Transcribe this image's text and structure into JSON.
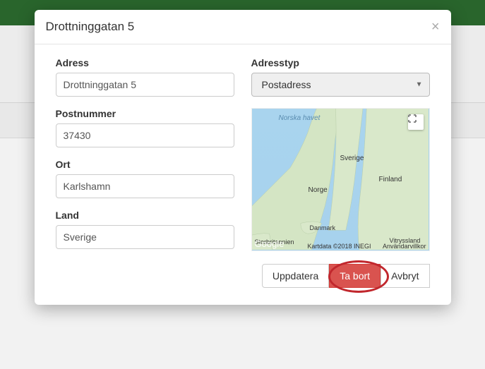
{
  "modal": {
    "title": "Drottninggatan 5",
    "close_symbol": "×"
  },
  "left": {
    "address_label": "Adress",
    "address_value": "Drottninggatan 5",
    "postal_label": "Postnummer",
    "postal_value": "37430",
    "city_label": "Ort",
    "city_value": "Karlshamn",
    "country_label": "Land",
    "country_value": "Sverige"
  },
  "right": {
    "type_label": "Adresstyp",
    "type_value": "Postadress"
  },
  "map": {
    "sea": "Norska havet",
    "norway": "Norge",
    "sweden": "Sverige",
    "finland": "Finland",
    "denmark": "Danmark",
    "uk": "Storbritannien",
    "belarus": "Vitryssland",
    "logo": "Google",
    "attr1": "Kartdata ©2018 INEGI",
    "attr2": "Användarvillkor"
  },
  "buttons": {
    "update": "Uppdatera",
    "delete": "Ta bort",
    "cancel": "Avbryt"
  }
}
